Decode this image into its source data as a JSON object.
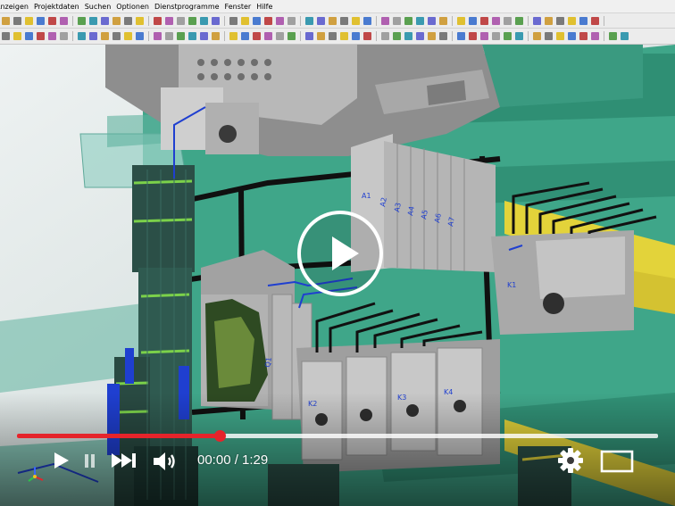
{
  "app": {
    "menu": [
      "Anzeigen",
      "Projektdaten",
      "Suchen",
      "Optionen",
      "Dienstprogramme",
      "Fenster",
      "Hilfe"
    ]
  },
  "scene": {
    "labels": {
      "a1": "A1",
      "a2": "A2",
      "a3": "A3",
      "a4": "A4",
      "a5": "A5",
      "a6": "A6",
      "a7": "A7",
      "k1": "K1",
      "q1": "Q1",
      "k2": "K2",
      "k3": "K3",
      "k4": "K4"
    }
  },
  "player": {
    "time_display": "00:00 / 1:29",
    "progress_fraction": 0.316
  },
  "icons": {
    "large_play": "play-icon",
    "play": "play-icon",
    "pause": "pause-icon",
    "skip": "skip-next-icon",
    "volume": "volume-icon",
    "settings": "gear-icon",
    "fullscreen": "fullscreen-icon",
    "logo": "axis-logo-icon"
  },
  "colors": {
    "accent": "#e5242b",
    "cabinet_green": "#3fa689",
    "rail_yellow": "#e3d33a",
    "wire_blue": "#1f3fd0"
  }
}
